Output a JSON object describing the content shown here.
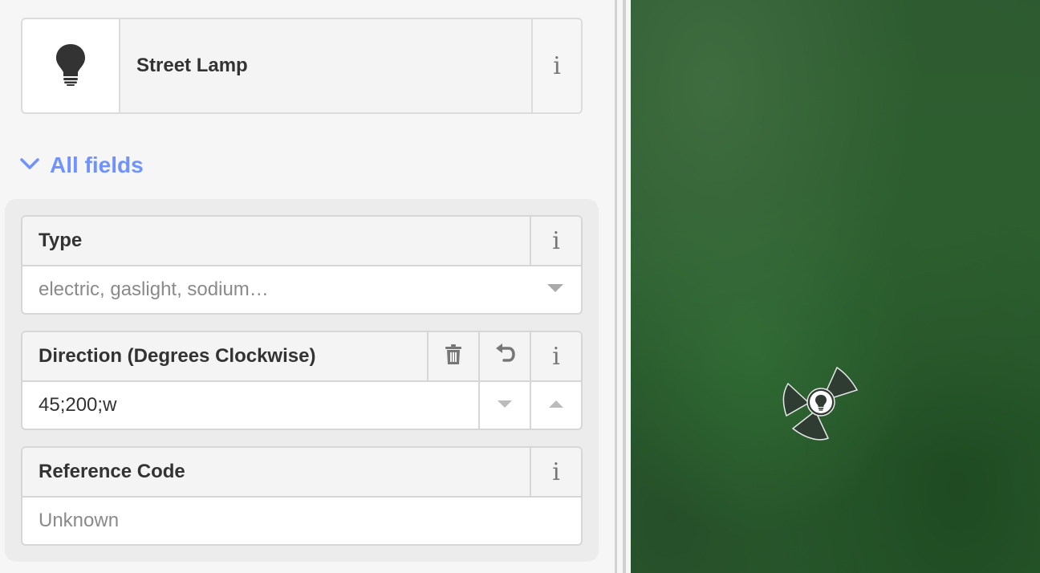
{
  "preset": {
    "icon": "lightbulb-icon",
    "name": "Street Lamp",
    "info_label": "i"
  },
  "section": {
    "toggle_icon": "chevron-down-icon",
    "label": "All fields"
  },
  "fields": {
    "type": {
      "label": "Type",
      "info_label": "i",
      "placeholder": "electric, gaslight, sodium…",
      "value": ""
    },
    "direction": {
      "label": "Direction (Degrees Clockwise)",
      "remove_icon": "trash-icon",
      "undo_icon": "undo-icon",
      "info_label": "i",
      "value": "45;200;w",
      "decrement_icon": "triangle-down-icon",
      "increment_icon": "triangle-up-icon"
    },
    "reference": {
      "label": "Reference Code",
      "info_label": "i",
      "placeholder": "Unknown",
      "value": ""
    }
  },
  "colors": {
    "accent": "#7092ff",
    "map_green": "#2c5e30",
    "vertex_fill": "#2f3a33"
  },
  "map": {
    "marker_icon": "street-lamp-vertex-icon",
    "viewfield_icon": "viewfield-wedge-icon"
  }
}
